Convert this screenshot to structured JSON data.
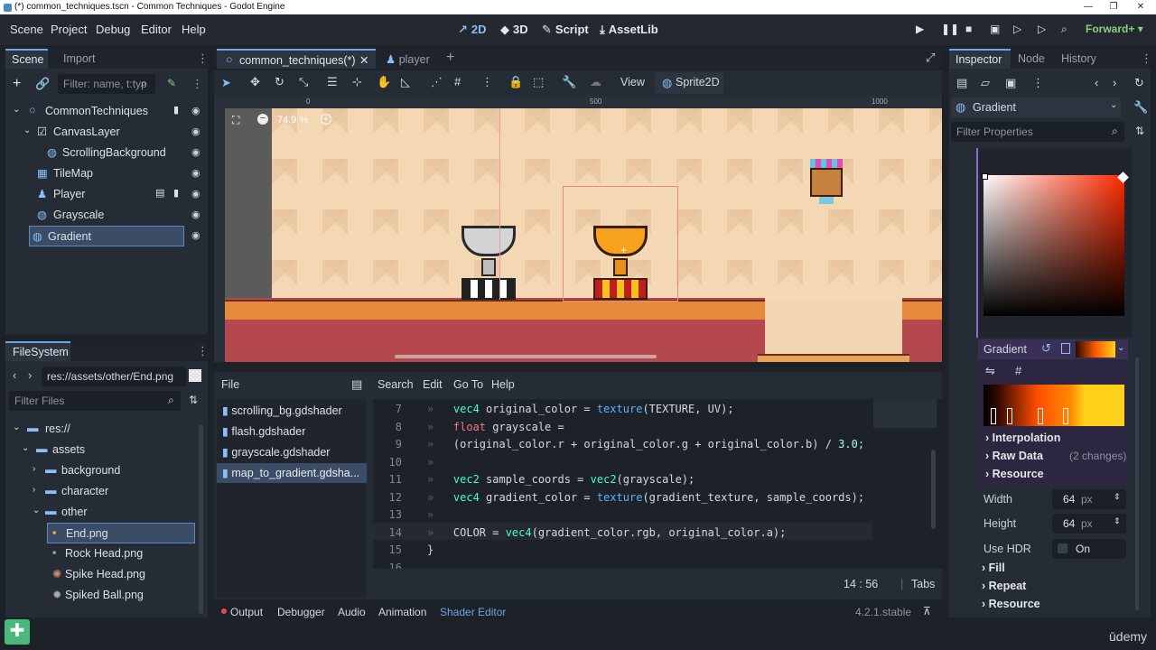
{
  "window": {
    "title": "(*) common_techniques.tscn - Common Techniques - Godot Engine"
  },
  "menu": {
    "items": [
      "Scene",
      "Project",
      "Debug",
      "Editor",
      "Help"
    ],
    "modes": [
      "2D",
      "3D",
      "Script",
      "AssetLib"
    ],
    "renderer": "Forward+"
  },
  "scene_dock": {
    "tabs": [
      "Scene",
      "Import"
    ],
    "filter_placeholder": "Filter: name, t:typ",
    "nodes": [
      {
        "label": "CommonTechniques"
      },
      {
        "label": "CanvasLayer"
      },
      {
        "label": "ScrollingBackground"
      },
      {
        "label": "TileMap"
      },
      {
        "label": "Player"
      },
      {
        "label": "Grayscale"
      },
      {
        "label": "Gradient"
      }
    ]
  },
  "filesystem": {
    "title": "FileSystem",
    "path": "res://assets/other/End.png",
    "filter_placeholder": "Filter Files",
    "items": [
      {
        "label": "res://"
      },
      {
        "label": "assets"
      },
      {
        "label": "background"
      },
      {
        "label": "character"
      },
      {
        "label": "other"
      },
      {
        "label": "End.png"
      },
      {
        "label": "Rock Head.png"
      },
      {
        "label": "Spike Head.png"
      },
      {
        "label": "Spiked Ball.png"
      }
    ]
  },
  "editor_tabs": {
    "tabs": [
      "common_techniques(*)",
      "player"
    ]
  },
  "toolbar": {
    "view_label": "View",
    "node_label": "Sprite2D"
  },
  "viewport": {
    "zoom": "74.9 %",
    "ruler": [
      "0",
      "500",
      "1000"
    ]
  },
  "script_editor": {
    "file_label": "File",
    "menus": [
      "Search",
      "Edit",
      "Go To",
      "Help"
    ],
    "files": [
      "scrolling_bg.gdshader",
      "flash.gdshader",
      "grayscale.gdshader",
      "map_to_gradient.gdsha..."
    ],
    "line_numbers": [
      "7",
      "8",
      "9",
      "10",
      "11",
      "12",
      "13",
      "14",
      "15",
      "16"
    ],
    "cursor": "14 :   56",
    "indent": "Tabs"
  },
  "bottom_panel": {
    "tabs": [
      "Output",
      "Debugger",
      "Audio",
      "Animation",
      "Shader Editor"
    ],
    "version": "4.2.1.stable"
  },
  "inspector": {
    "tabs": [
      "Inspector",
      "Node",
      "History"
    ],
    "resource": "Gradient",
    "filter_placeholder": "Filter Properties",
    "gradient_label": "Gradient",
    "sections": [
      "Interpolation",
      "Raw Data",
      "Resource"
    ],
    "raw_data_changes": "(2 changes)",
    "width_label": "Width",
    "width_value": "64",
    "height_label": "Height",
    "height_value": "64",
    "unit": "px",
    "hdr_label": "Use HDR",
    "hdr_value": "On",
    "bottom_sections": [
      "Fill",
      "Repeat",
      "Resource"
    ]
  },
  "watermark": "ūdemy"
}
